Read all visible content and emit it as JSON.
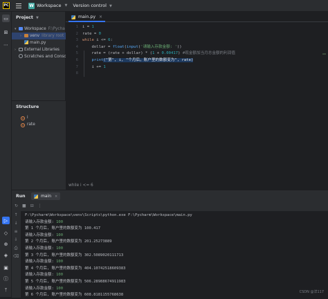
{
  "titlebar": {
    "logo": "PC",
    "workspace_badge": "W",
    "workspace": "Workspace",
    "version_control": "Version control"
  },
  "project": {
    "title": "Project",
    "tree": [
      {
        "name": "Workspace",
        "suffix": "F:\\Pycha",
        "depth": 0,
        "arrow": "v",
        "icon": "folder"
      },
      {
        "name": "venv",
        "suffix": "library root",
        "depth": 1,
        "arrow": ">",
        "icon": "folder-orange",
        "selected": true
      },
      {
        "name": "main.py",
        "suffix": "",
        "depth": 1,
        "arrow": "",
        "icon": "python"
      },
      {
        "name": "External Libraries",
        "suffix": "",
        "depth": 0,
        "arrow": ">",
        "icon": "library"
      },
      {
        "name": "Scratches and Conso",
        "suffix": "",
        "depth": 0,
        "arrow": "",
        "icon": "scratch"
      }
    ]
  },
  "structure": {
    "title": "Structure",
    "items": [
      {
        "icon_letter": "v",
        "name": "i"
      },
      {
        "icon_letter": "v",
        "name": "rate"
      }
    ]
  },
  "editor": {
    "tab": "main.py",
    "line_numbers": [
      "1",
      "2",
      "3",
      "4",
      "5",
      "6",
      "7",
      "8"
    ],
    "lines": [
      {
        "parts": [
          {
            "t": "i = ",
            "c": ""
          },
          {
            "t": "1",
            "c": "num"
          }
        ]
      },
      {
        "parts": [
          {
            "t": "rate = ",
            "c": ""
          },
          {
            "t": "0",
            "c": "num"
          }
        ]
      },
      {
        "parts": [
          {
            "t": "while",
            "c": "kw"
          },
          {
            "t": " i <= ",
            "c": ""
          },
          {
            "t": "6",
            "c": "num"
          },
          {
            "t": ":",
            "c": ""
          }
        ]
      },
      {
        "parts": [
          {
            "t": "    dollar = ",
            "c": ""
          },
          {
            "t": "float",
            "c": "fn"
          },
          {
            "t": "(",
            "c": ""
          },
          {
            "t": "input",
            "c": "fn"
          },
          {
            "t": "(",
            "c": ""
          },
          {
            "t": "'请输入存款金额: '",
            "c": "str"
          },
          {
            "t": "))",
            "c": ""
          }
        ]
      },
      {
        "parts": [
          {
            "t": "    rate = (rate + dollar) * (",
            "c": ""
          },
          {
            "t": "1",
            "c": "num"
          },
          {
            "t": " + ",
            "c": ""
          },
          {
            "t": "0.00417",
            "c": "num"
          },
          {
            "t": ") ",
            "c": ""
          },
          {
            "t": "#现金额加当月总金额的利润值",
            "c": "cmt"
          }
        ]
      },
      {
        "parts": [
          {
            "t": "    ",
            "c": ""
          },
          {
            "t": "print",
            "c": "fn"
          },
          {
            "t": "(",
            "c": ""
          },
          {
            "t": "\"第\"",
            "c": "str"
          },
          {
            "t": ", i, ",
            "c": ""
          },
          {
            "t": "\"个月后，账户里的数额变为\"",
            "c": "str"
          },
          {
            "t": ", rate)",
            "c": ""
          }
        ]
      },
      {
        "parts": [
          {
            "t": "    i += ",
            "c": ""
          },
          {
            "t": "1",
            "c": "num"
          }
        ]
      },
      {
        "parts": [
          {
            "t": "",
            "c": ""
          }
        ]
      }
    ],
    "breadcrumb": "while i <= 6"
  },
  "run": {
    "label": "Run",
    "tab": "main",
    "command": "F:\\Pycharm\\Workspace\\venv\\Scripts\\python.exe F:\\Pycharm\\Workspace\\main.py",
    "output": [
      {
        "prompt": "请输入存款金额: ",
        "input": "100"
      },
      {
        "text": "第 1 个月后, 账户里的数额变为 100.417"
      },
      {
        "prompt": "请输入存款金额: ",
        "input": "100"
      },
      {
        "text": "第 2 个月后, 账户里的数额变为 201.25273889"
      },
      {
        "prompt": "请输入存款金额: ",
        "input": "100"
      },
      {
        "text": "第 3 个月后, 账户里的数额变为 302.5089020111713"
      },
      {
        "prompt": "请输入存款金额: ",
        "input": "100"
      },
      {
        "text": "第 4 个月后, 账户里的数额变为 404.10742518609383"
      },
      {
        "prompt": "请输入存款金额: ",
        "input": "100"
      },
      {
        "text": "第 5 个月后, 账户里的数额变为 506.28988674911983"
      },
      {
        "prompt": "请输入存款金额: ",
        "input": "100"
      },
      {
        "text": "第 6 个月后, 账户里的数额变为 608.8181155768638"
      }
    ]
  },
  "watermark": "CSDN @洋117",
  "colors": {
    "accent": "#3574f0",
    "background": "#1e1f22",
    "panel": "#2b2d30",
    "keyword": "#cf8e6d",
    "number": "#2aacb8",
    "string": "#6aab73",
    "function": "#56a8f5"
  }
}
